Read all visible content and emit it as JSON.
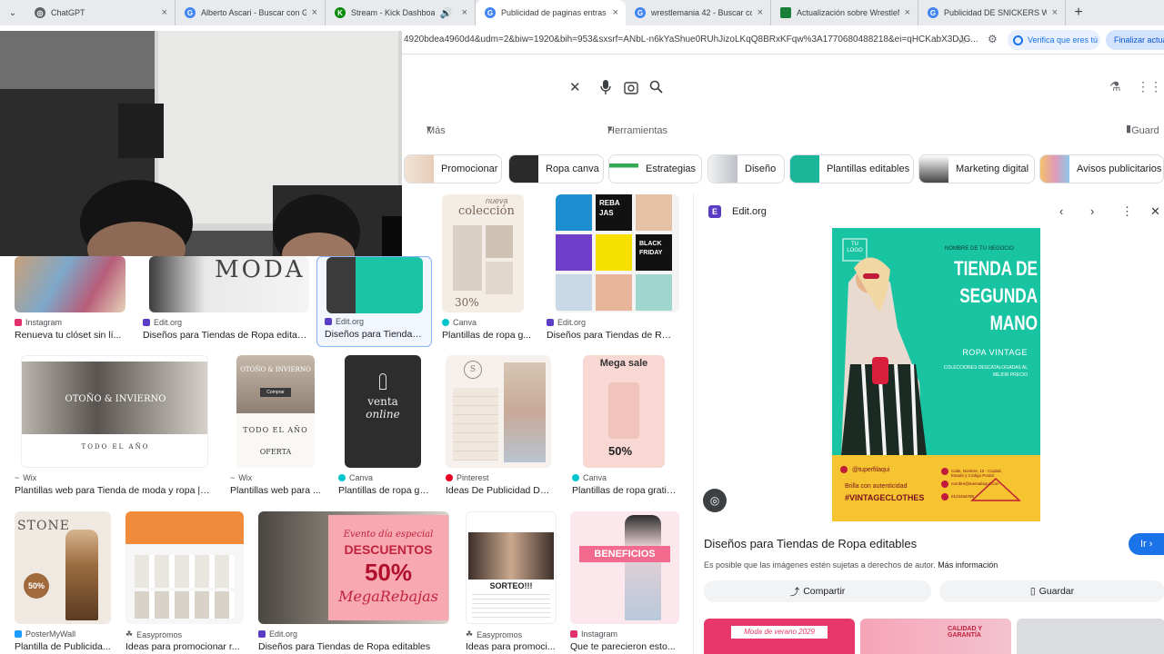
{
  "tabs": [
    {
      "title": "ChatGPT",
      "color": "#5f6368",
      "glyph": "◎"
    },
    {
      "title": "Alberto Ascari - Buscar con Goo",
      "color": "#4285f4",
      "glyph": "G"
    },
    {
      "title": "Stream - Kick Dashboard",
      "color": "#53fc18",
      "glyph": "K"
    },
    {
      "title": "Publicidad de paginas entras d",
      "color": "#4285f4",
      "glyph": "G"
    },
    {
      "title": "wrestlemania 42 - Buscar con G",
      "color": "#4285f4",
      "glyph": "G"
    },
    {
      "title": "Actualización sobre WrestleMa",
      "color": "#188038",
      "glyph": "▣"
    },
    {
      "title": "Publicidad DE SNICKERS WWE",
      "color": "#4285f4",
      "glyph": "G"
    }
  ],
  "address": {
    "url": "4920bdea4960d4&udm=2&biw=1920&bih=953&sxsrf=ANbL-n6kYaShue0RUhJizoLKqQ8BRxKFqw%3A1770680488218&ei=qHCKabX3DJG...",
    "verify_label": "Verifica que eres tú",
    "finalize_label": "Finalizar actual"
  },
  "tools": {
    "more": "Más",
    "tools": "Herramientas",
    "save": "Guard"
  },
  "chips": [
    {
      "label": "Promocionar",
      "color": "#e7cdb8"
    },
    {
      "label": "Ropa canva",
      "color": "#2b2b2b"
    },
    {
      "label": "Estrategias",
      "color": "#34a853"
    },
    {
      "label": "Diseño",
      "color": "#bdc1c6"
    },
    {
      "label": "Plantillas editables",
      "color": "#1bb59a"
    },
    {
      "label": "Marketing digital",
      "color": "#444444"
    },
    {
      "label": "Avisos publicitarios",
      "color": "#e09ab7"
    }
  ],
  "results": {
    "row1": [
      {
        "source": "Instagram",
        "caption": "Renueva tu clóset sin lí...",
        "icon_color": "#e1306c"
      },
      {
        "source": "Edit.org",
        "caption": "Diseños para Tiendas de Ropa editabl...",
        "icon_color": "#5b3cc4"
      },
      {
        "source": "Edit.org",
        "caption": "Diseños para Tiendas ...",
        "icon_color": "#5b3cc4"
      },
      {
        "source": "Canva",
        "caption": "Plantillas de ropa g...",
        "icon_color": "#00c4cc"
      },
      {
        "source": "Edit.org",
        "caption": "Diseños para Tiendas de Ropa...",
        "icon_color": "#5b3cc4"
      }
    ],
    "row2": [
      {
        "source": "Wix",
        "caption": "Plantillas web para Tienda de moda y ropa | e...",
        "icon_color": "#202124"
      },
      {
        "source": "Wix",
        "caption": "Plantillas web para ...",
        "icon_color": "#202124"
      },
      {
        "source": "Canva",
        "caption": "Plantillas de ropa gr...",
        "icon_color": "#00c4cc"
      },
      {
        "source": "Pinterest",
        "caption": "Ideas De Publicidad De ...",
        "icon_color": "#e60023"
      },
      {
        "source": "Canva",
        "caption": "Plantillas de ropa gratis...",
        "icon_color": "#00c4cc"
      }
    ],
    "row3": [
      {
        "source": "PosterMyWall",
        "caption": "Plantilla de Publicida...",
        "icon_color": "#1a9cff"
      },
      {
        "source": "Easypromos",
        "caption": "Ideas para promocionar r...",
        "icon_color": "#202124"
      },
      {
        "source": "Edit.org",
        "caption": "Diseños para Tiendas de Ropa editables",
        "icon_color": "#5b3cc4"
      },
      {
        "source": "Easypromos",
        "caption": "Ideas para promoci...",
        "icon_color": "#202124"
      },
      {
        "source": "Instagram",
        "caption": "Que te parecieron esto...",
        "icon_color": "#e1306c"
      }
    ]
  },
  "image_text": {
    "r1_moda": "MODA",
    "r1_coleccion": "colección",
    "r1_nueva": "nueva",
    "r1_pct": "30%",
    "r1_rebajas": "REBA JAS",
    "r1_black": "BLACK FRIDAY",
    "r2_otono": "OTOÑO & INVIERNO",
    "r2_todo": "TODO EL AÑO",
    "r2_oferta": "OFERTA",
    "r2_campaign": "Comprar",
    "r2_venta": "venta",
    "r2_online": "online",
    "r2_mega": "Mega sale",
    "r2_pct": "50%",
    "r3_stone": "STONE",
    "r3_stone_pct": "50%",
    "r3_evento": "Evento día especial",
    "r3_descuentos": "DESCUENTOS",
    "r3_50": "50%",
    "r3_mega": "MegaRebajas",
    "r3_sorteo": "SORTEO!!!",
    "r3_beneficios": "BENEFICIOS"
  },
  "panel": {
    "source": "Edit.org",
    "title": "Diseños para Tiendas de Ropa editables",
    "go_label": "Ir",
    "note": "Es posible que las imágenes estén sujetas a derechos de autor.",
    "note_link": "Más información",
    "share_label": "Compartir",
    "save_label": "Guardar",
    "poster": {
      "logo_line1": "TU",
      "logo_line2": "LOGO",
      "business": "NOMBRE DE TU NEGOCIO",
      "headline1": "TIENDA DE",
      "headline2": "SEGUNDA",
      "headline3": "MANO",
      "sub": "ROPA VINTAGE",
      "sub2": "COLECCIONES DESCATALOGADAS AL MEJOR PRECIO",
      "handle": "@tuperfilaqui",
      "tagline1": "Brilla con autenticidad",
      "tagline2": "#VINTAGECLOTHES",
      "address": "Calle, Nombre, 10 - Ciudad, Estado y Código Postal",
      "email": "nombre@tuemailaqui.com",
      "phone": "0123456789"
    },
    "related_text": [
      "Moda de verano 2029",
      "CALIDAD Y GARANTÍA"
    ]
  }
}
